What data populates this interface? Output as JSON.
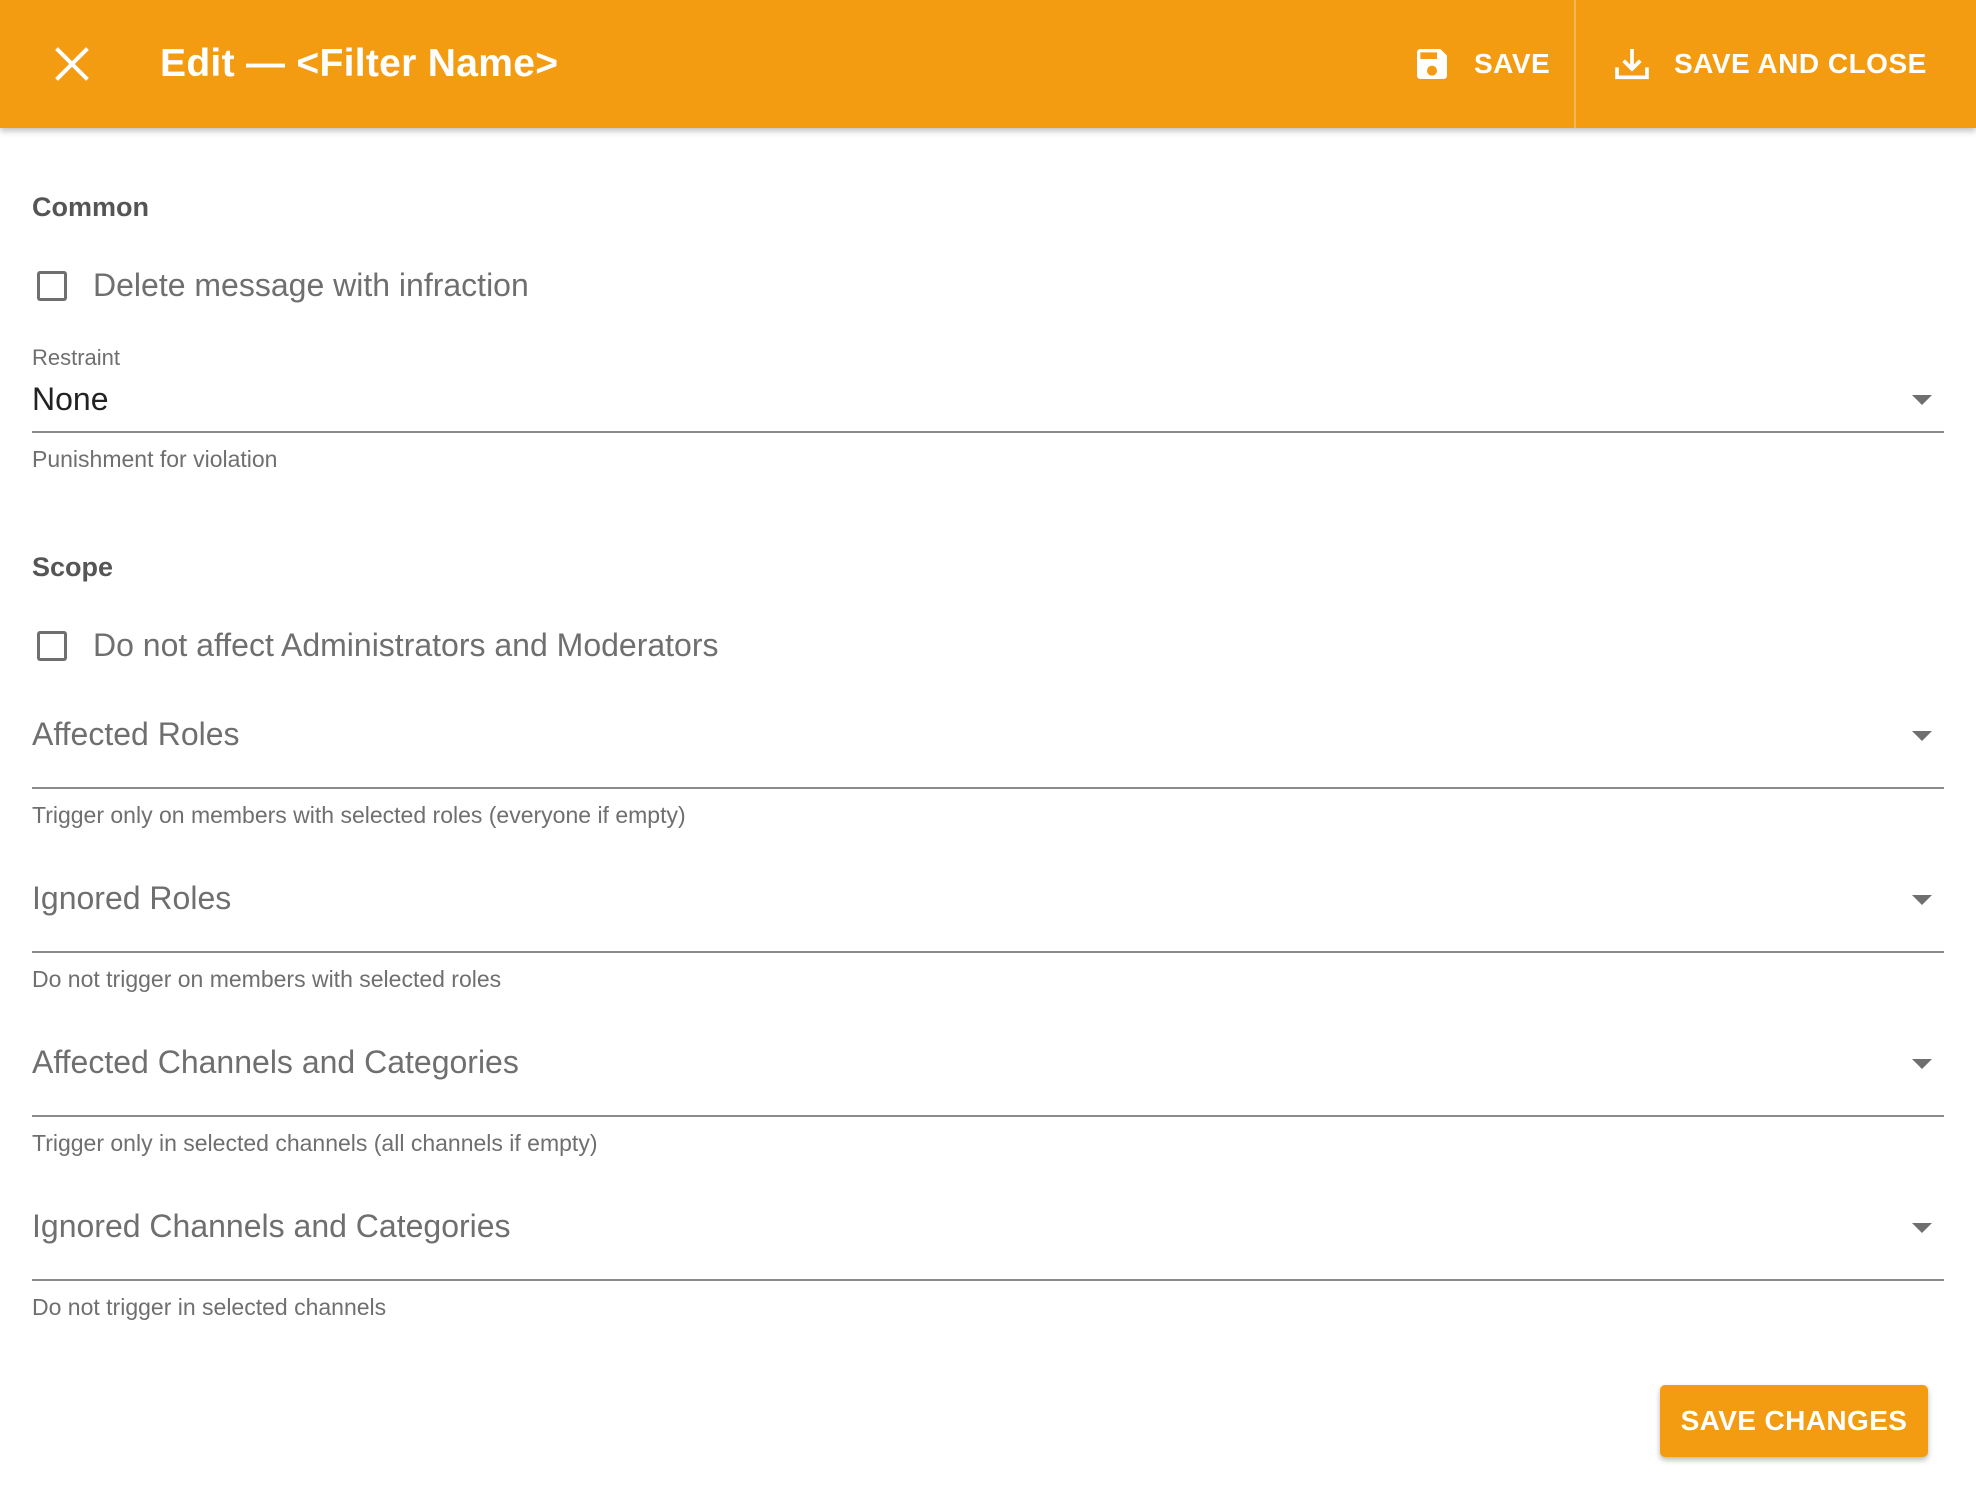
{
  "toolbar": {
    "close_icon": "close-icon",
    "title": "Edit — <Filter Name>",
    "save_label": "SAVE",
    "save_icon": "floppy-disk-icon",
    "save_close_label": "SAVE AND CLOSE",
    "save_close_icon": "download-tray-icon",
    "background_color": "#f39c12"
  },
  "common": {
    "section_title": "Common",
    "delete_message": {
      "label": "Delete message with infraction",
      "checked": false
    },
    "restraint": {
      "label": "Restraint",
      "value": "None",
      "helper": "Punishment for violation"
    }
  },
  "scope": {
    "section_title": "Scope",
    "exclude_mods": {
      "label": "Do not affect Administrators and Moderators",
      "checked": false
    },
    "affected_roles": {
      "placeholder": "Affected Roles",
      "helper": "Trigger only on members with selected roles (everyone if empty)"
    },
    "ignored_roles": {
      "placeholder": "Ignored Roles",
      "helper": "Do not trigger on members with selected roles"
    },
    "affected_channels": {
      "placeholder": "Affected Channels and Categories",
      "helper": "Trigger only in selected channels (all channels if empty)"
    },
    "ignored_channels": {
      "placeholder": "Ignored Channels and Categories",
      "helper": "Do not trigger in selected channels"
    }
  },
  "footer": {
    "save_changes_label": "SAVE CHANGES"
  }
}
